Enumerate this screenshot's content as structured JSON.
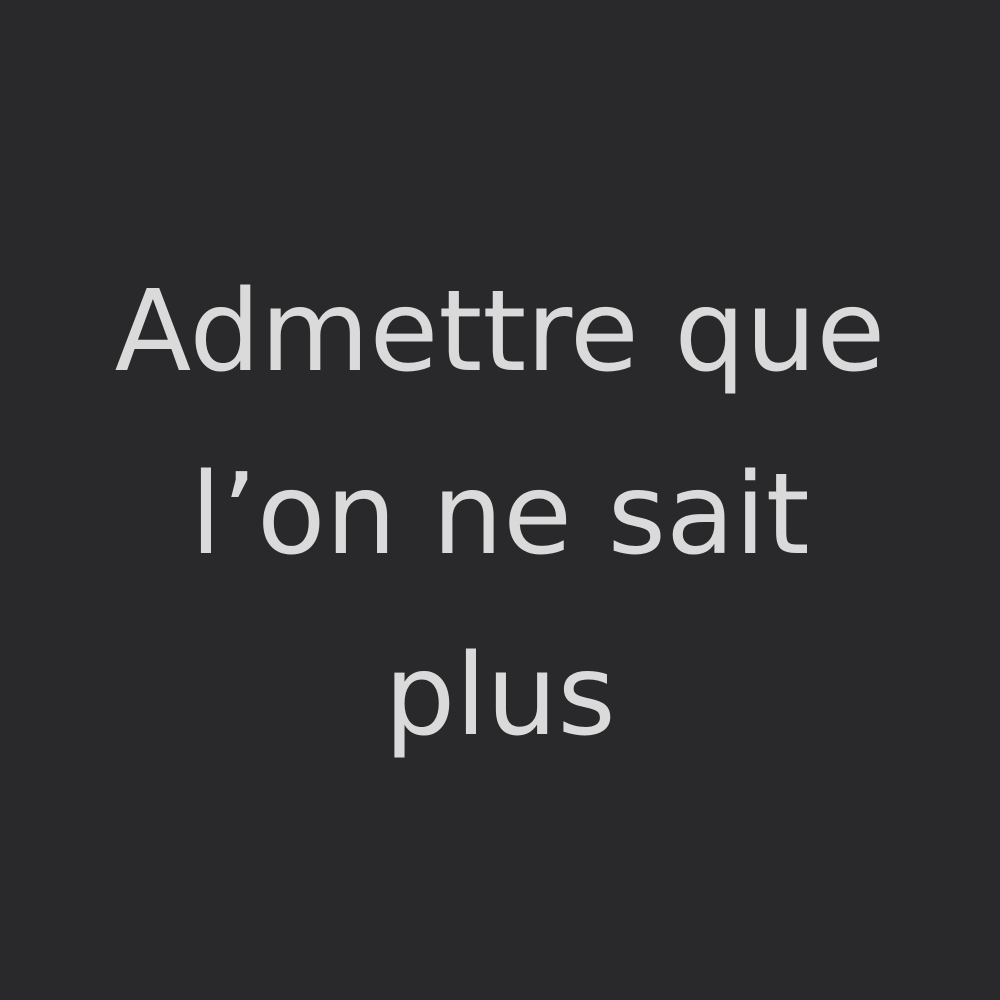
{
  "quote": {
    "lines": [
      "Admettre que",
      "l’on ne sait",
      "plus"
    ]
  },
  "colors": {
    "background": "#29292b",
    "text": "#dadada"
  }
}
